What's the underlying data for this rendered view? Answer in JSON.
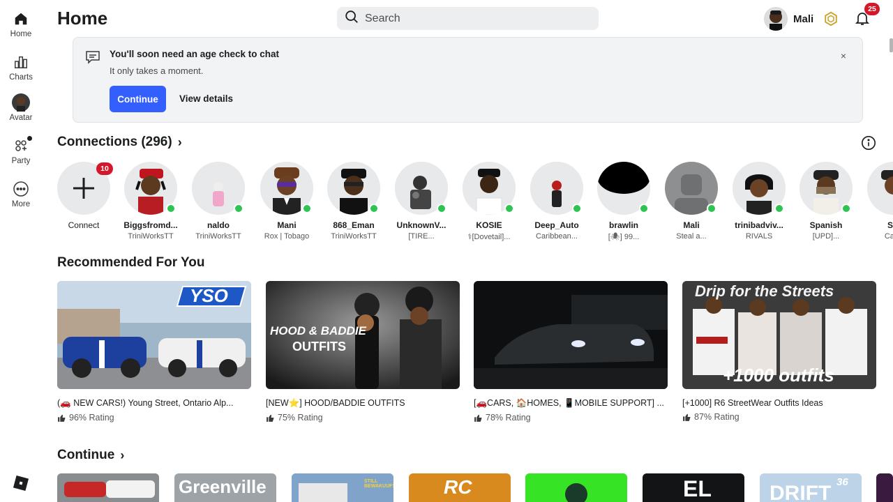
{
  "nav": {
    "items": [
      {
        "label": "Home",
        "icon": "home-icon"
      },
      {
        "label": "Charts",
        "icon": "charts-icon"
      },
      {
        "label": "Avatar",
        "icon": "avatar-icon"
      },
      {
        "label": "Party",
        "icon": "party-icon"
      },
      {
        "label": "More",
        "icon": "more-icon"
      }
    ]
  },
  "header": {
    "title": "Home",
    "search_placeholder": "Search",
    "user_name": "Mali",
    "notification_count": "25"
  },
  "banner": {
    "title": "You'll soon need an age check to chat",
    "subtitle": "It only takes a moment.",
    "continue_label": "Continue",
    "details_label": "View details",
    "close_glyph": "×"
  },
  "connections": {
    "title": "Connections (296)",
    "chevron": "›",
    "connect": {
      "label": "Connect",
      "badge": "10"
    },
    "items": [
      {
        "name": "Biggsfromd...",
        "sub": "TriniWorksTT"
      },
      {
        "name": "naldo",
        "sub": "TriniWorksTT"
      },
      {
        "name": "Mani",
        "sub": "Rox | Tobago"
      },
      {
        "name": "868_Eman",
        "sub": "TriniWorksTT"
      },
      {
        "name": "UnknownV...",
        "sub": "[TIRE..."
      },
      {
        "name": "KOSIE",
        "sub": "⚕[Dovetail]..."
      },
      {
        "name": "Deep_Auto",
        "sub": "Caribbean..."
      },
      {
        "name": "brawlin",
        "sub": "[🕷] 99..."
      },
      {
        "name": "Mali",
        "sub": "Steal a..."
      },
      {
        "name": "trinibadviv...",
        "sub": "RIVALS"
      },
      {
        "name": "Spanish",
        "sub": "[UPD]..."
      },
      {
        "name": "SM",
        "sub": "Carib"
      }
    ]
  },
  "recommended": {
    "title": "Recommended For You",
    "cards": [
      {
        "title": "(🚗 NEW CARS!) Young Street, Ontario Alp...",
        "rating": "96% Rating",
        "thumb_text": "YSO"
      },
      {
        "title": "[NEW⭐] HOOD/BADDIE OUTFITS",
        "rating": "75% Rating",
        "thumb_text_1": "HOOD & BADDIE",
        "thumb_text_2": "OUTFITS"
      },
      {
        "title": "[🚗CARS, 🏠HOMES, 📱MOBILE SUPPORT] ...",
        "rating": "78% Rating"
      },
      {
        "title": "[+1000] R6 StreetWear Outfits Ideas",
        "rating": "87% Rating",
        "thumb_text_1": "Drip for the Streets",
        "thumb_text_2": "+1000 outfits"
      }
    ]
  },
  "continue_section": {
    "title": "Continue",
    "chevron": "›",
    "tiles": [
      {
        "label": ""
      },
      {
        "label": "Greenville"
      },
      {
        "label": "STILL BEWAKUUFS"
      },
      {
        "label": "RC"
      },
      {
        "label": ""
      },
      {
        "label": "EL"
      },
      {
        "label": "DRIFT",
        "badge": "36"
      },
      {
        "label": ""
      }
    ]
  },
  "colors": {
    "accent": "#335fff",
    "badge": "#d3182b",
    "online": "#2fc452"
  }
}
